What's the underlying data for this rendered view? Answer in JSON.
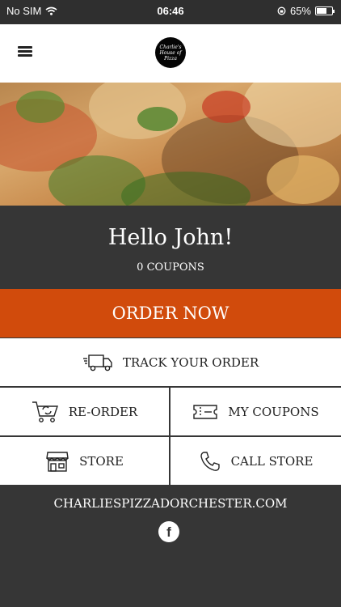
{
  "status_bar": {
    "carrier": "No SIM",
    "time": "06:46",
    "battery": "65%",
    "battery_level": 0.65
  },
  "header": {
    "logo_text": "Charlie's House of Pizza"
  },
  "greeting": {
    "title": "Hello John!",
    "coupons": "0 COUPONS"
  },
  "actions": {
    "order_now": "ORDER NOW",
    "track_order": "TRACK YOUR ORDER",
    "reorder": "RE-ORDER",
    "my_coupons": "MY COUPONS",
    "store": "STORE",
    "call_store": "CALL STORE"
  },
  "footer": {
    "website": "CHARLIESPIZZADORCHESTER.COM",
    "social": "f"
  },
  "colors": {
    "accent": "#d14b0c",
    "dark": "#363636",
    "status_bar": "#2f2f2f"
  }
}
